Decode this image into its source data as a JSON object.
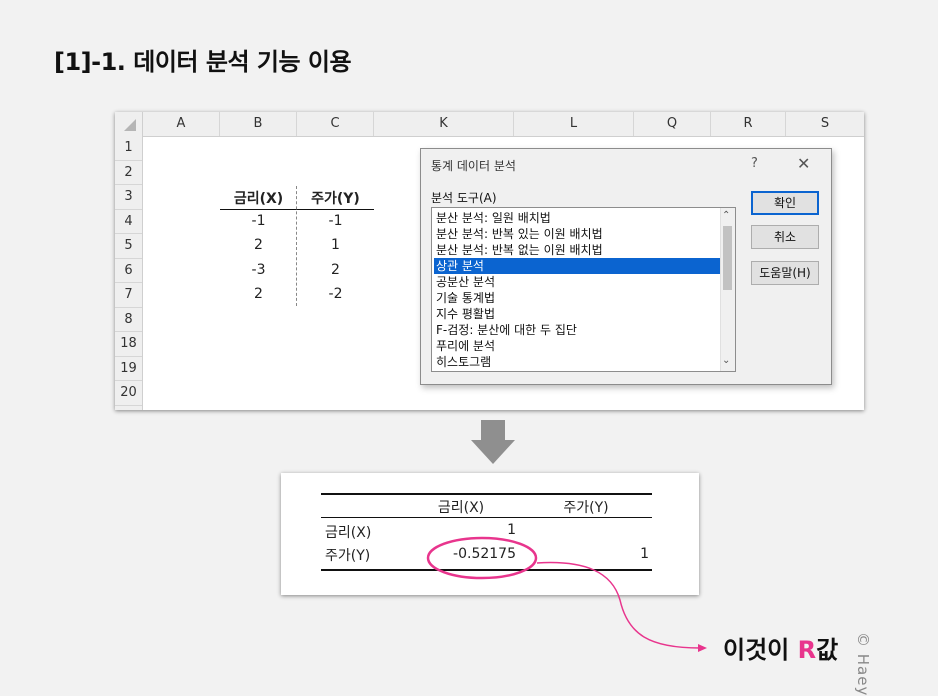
{
  "page_title": "[1]-1. 데이터 분석 기능 이용",
  "sheet": {
    "columns": [
      "A",
      "B",
      "C",
      "K",
      "L",
      "Q",
      "R",
      "S"
    ],
    "rows": [
      "1",
      "2",
      "3",
      "4",
      "5",
      "6",
      "7",
      "8",
      "18",
      "19",
      "20"
    ],
    "table": {
      "headers": [
        "금리(X)",
        "주가(Y)"
      ],
      "rows": [
        [
          "-1",
          "-1"
        ],
        [
          "2",
          "1"
        ],
        [
          "-3",
          "2"
        ],
        [
          "2",
          "-2"
        ]
      ]
    }
  },
  "dialog": {
    "title": "통계 데이터 분석",
    "help_glyph": "?",
    "close_glyph": "✕",
    "tools_label": "분석 도구(A)",
    "tools": [
      "분산 분석: 일원 배치법",
      "분산 분석: 반복 있는 이원 배치법",
      "분산 분석: 반복 없는 이원 배치법",
      "상관 분석",
      "공분산 분석",
      "기술 통계법",
      "지수 평활법",
      "F-검정: 분산에 대한 두 집단",
      "푸리에 분석",
      "히스토그램"
    ],
    "selected_tool": "상관 분석",
    "ok_label": "확인",
    "cancel_label": "취소",
    "help_label": "도움말(H)"
  },
  "result": {
    "col_headers": [
      "금리(X)",
      "주가(Y)"
    ],
    "rows": [
      {
        "label": "금리(X)",
        "values": [
          "1",
          ""
        ]
      },
      {
        "label": "주가(Y)",
        "values": [
          "-0.52175",
          "1"
        ]
      }
    ]
  },
  "annotation": {
    "prefix": "이것이 ",
    "highlight": "R",
    "suffix": "값"
  },
  "watermark": "© Haey",
  "colors": {
    "accent": "#e8358d",
    "selection": "#0b64d0"
  }
}
